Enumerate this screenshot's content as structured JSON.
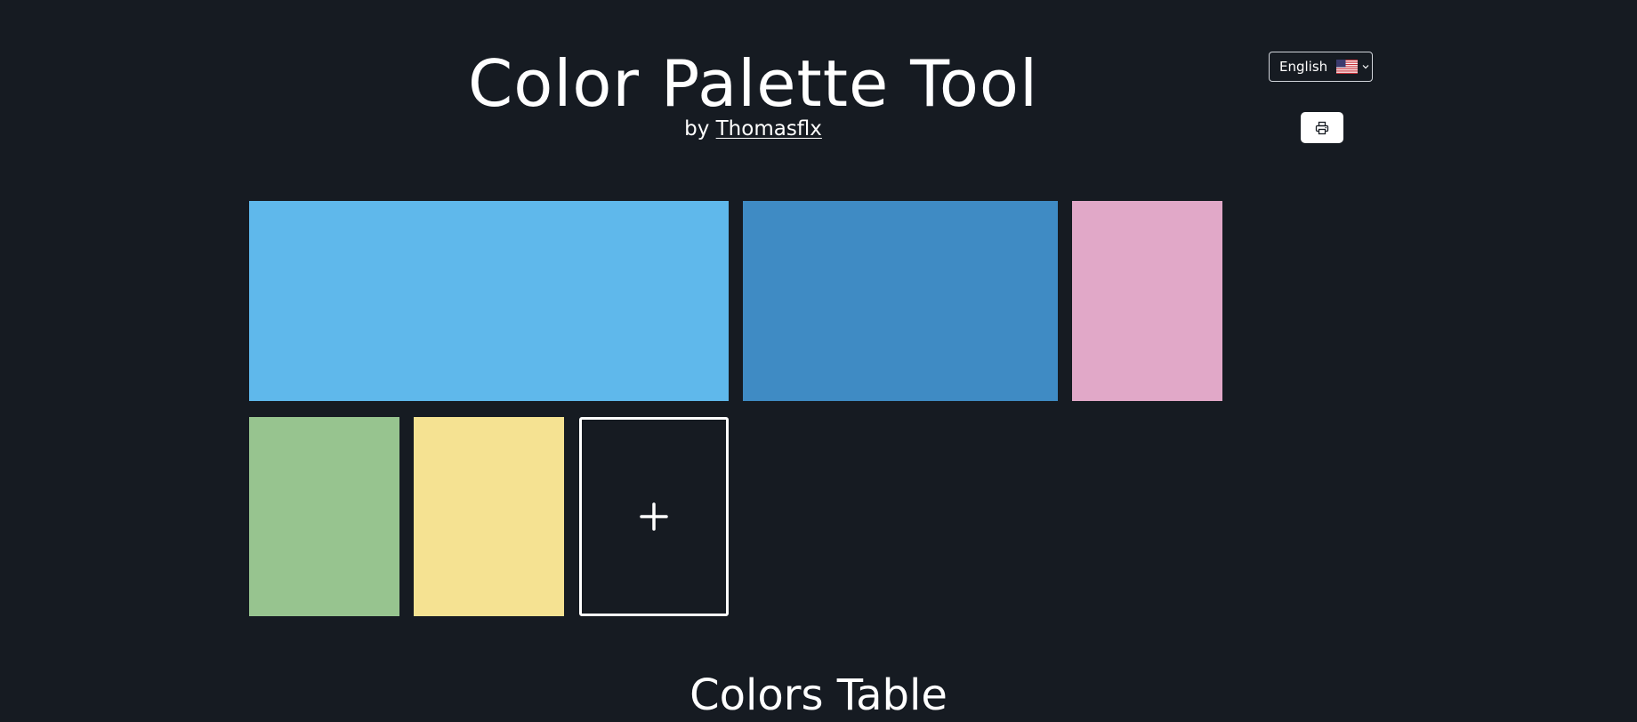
{
  "header": {
    "title": "Color Palette Tool",
    "byline_prefix": "by",
    "author": "Thomasflx"
  },
  "language": {
    "selected": "English",
    "flag_icon": "us-flag-icon"
  },
  "toolbar": {
    "print_icon": "printer-icon"
  },
  "palette": {
    "swatches": [
      {
        "color": "#5fb8eb"
      },
      {
        "color": "#3f8bc4"
      },
      {
        "color": "#e1a8c8"
      },
      {
        "color": "#97c48f"
      },
      {
        "color": "#f5e292"
      }
    ],
    "add_label": "+"
  },
  "table": {
    "title": "Colors Table"
  }
}
